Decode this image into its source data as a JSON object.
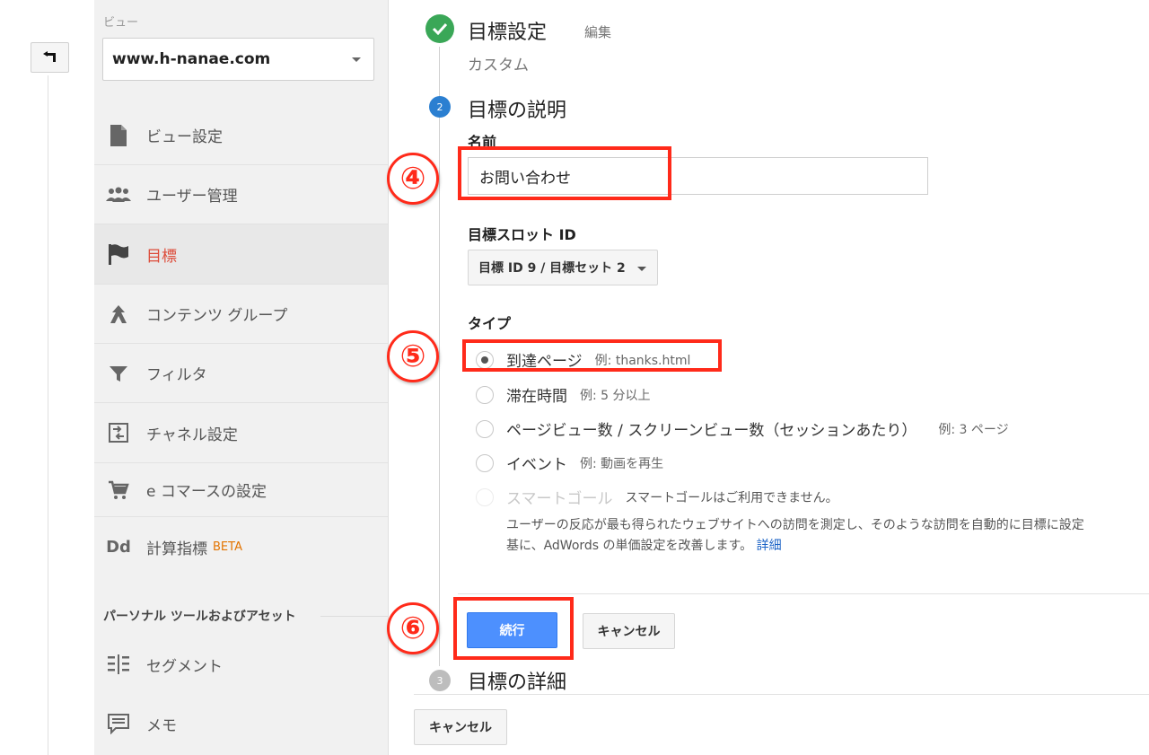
{
  "sidebar": {
    "view_label": "ビュー",
    "view_select": "www.h-nanae.com",
    "items": [
      {
        "label": "ビュー設定",
        "icon": "document-icon"
      },
      {
        "label": "ユーザー管理",
        "icon": "users-icon"
      },
      {
        "label": "目標",
        "icon": "flag-icon",
        "active": true
      },
      {
        "label": "コンテンツ グループ",
        "icon": "content-group-icon"
      },
      {
        "label": "フィルタ",
        "icon": "filter-icon"
      },
      {
        "label": "チャネル設定",
        "icon": "channel-icon"
      },
      {
        "label": "e コマースの設定",
        "icon": "cart-icon"
      },
      {
        "label": "計算指標",
        "icon": "dd-icon",
        "badge": "BETA"
      }
    ],
    "section_title": "パーソナル ツールおよびアセット",
    "personal_items": [
      {
        "label": "セグメント",
        "icon": "segment-icon"
      },
      {
        "label": "メモ",
        "icon": "note-icon"
      }
    ]
  },
  "steps": {
    "step1": {
      "title": "目標設定",
      "edit": "編集",
      "value": "カスタム"
    },
    "step2": {
      "number": "2",
      "title": "目標の説明"
    },
    "step3": {
      "number": "3",
      "title": "目標の詳細"
    }
  },
  "form": {
    "name_label": "名前",
    "name_value": "お問い合わせ",
    "slot_label": "目標スロット ID",
    "slot_value": "目標 ID 9 / 目標セット 2",
    "type_label": "タイプ",
    "types": [
      {
        "label": "到達ページ",
        "example": "例: thanks.html",
        "checked": true
      },
      {
        "label": "滞在時間",
        "example": "例: 5 分以上"
      },
      {
        "label": "ページビュー数 / スクリーンビュー数（セッションあたり）",
        "example": "例: 3 ページ"
      },
      {
        "label": "イベント",
        "example": "例: 動画を再生"
      },
      {
        "label": "スマートゴール",
        "example": "スマートゴールはご利用できません。",
        "disabled": true
      }
    ],
    "smart_desc_1": "ユーザーの反応が最も得られたウェブサイトへの訪問を測定し、そのような訪問を自動的に目標に設定",
    "smart_desc_2": "基に、AdWords の単価設定を改善します。",
    "smart_link": "詳細"
  },
  "buttons": {
    "continue": "続行",
    "cancel": "キャンセル",
    "cancel_bottom": "キャンセル"
  },
  "annotations": {
    "n4": "④",
    "n5": "⑤",
    "n6": "⑥",
    "color": "#ff2a1a"
  }
}
